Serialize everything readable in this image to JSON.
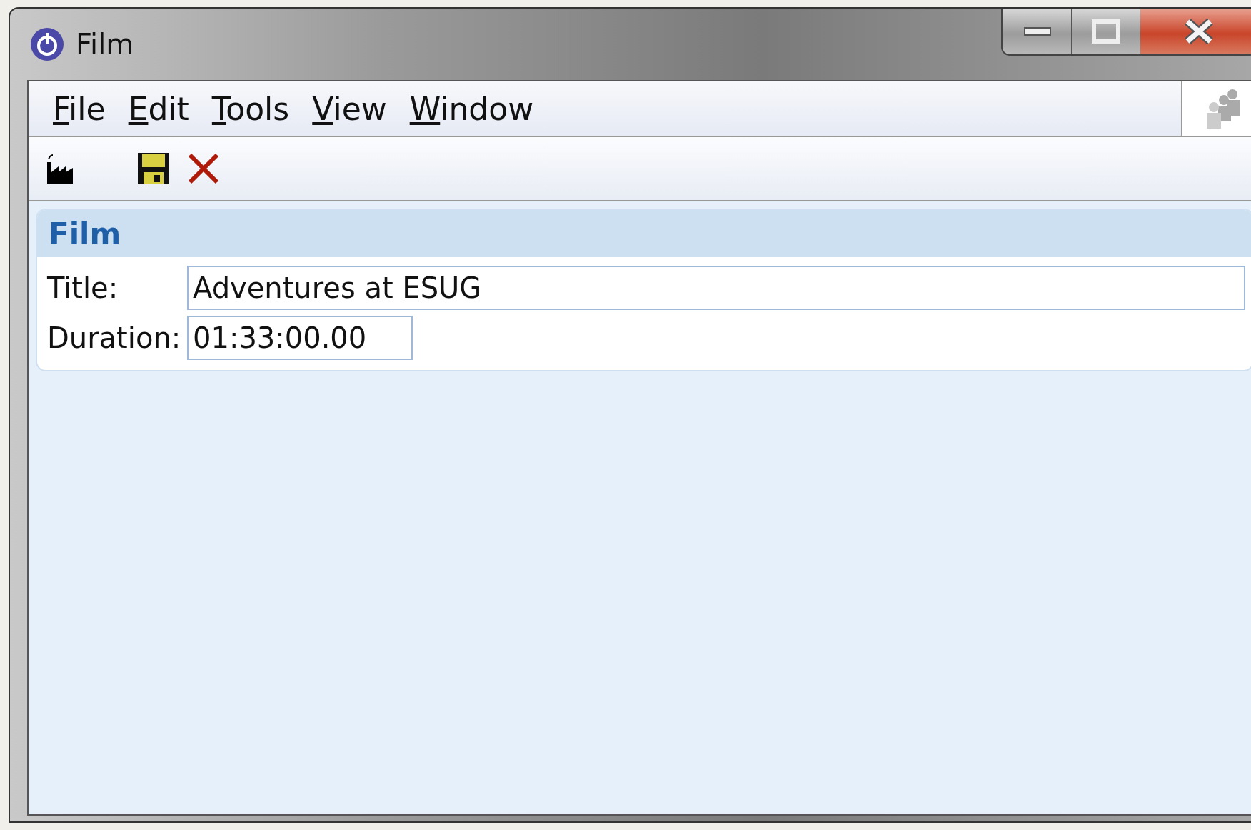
{
  "window": {
    "title": "Film"
  },
  "menu": [
    {
      "label": "File",
      "mnemonic_underlined": true
    },
    {
      "label": "Edit",
      "mnemonic_underlined": true
    },
    {
      "label": "Tools",
      "mnemonic_underlined": true
    },
    {
      "label": "View",
      "mnemonic_underlined": true
    },
    {
      "label": "Window",
      "mnemonic_underlined": true
    }
  ],
  "toolbar": [
    {
      "kind": "factory"
    },
    {
      "kind": "save"
    },
    {
      "kind": "delete"
    }
  ],
  "panel": {
    "title": "Film",
    "fields": [
      {
        "label": "Title:",
        "value": "Adventures at ESUG",
        "wide": true
      },
      {
        "label": "Duration:",
        "value": "01:33:00.00",
        "wide": false
      }
    ]
  }
}
